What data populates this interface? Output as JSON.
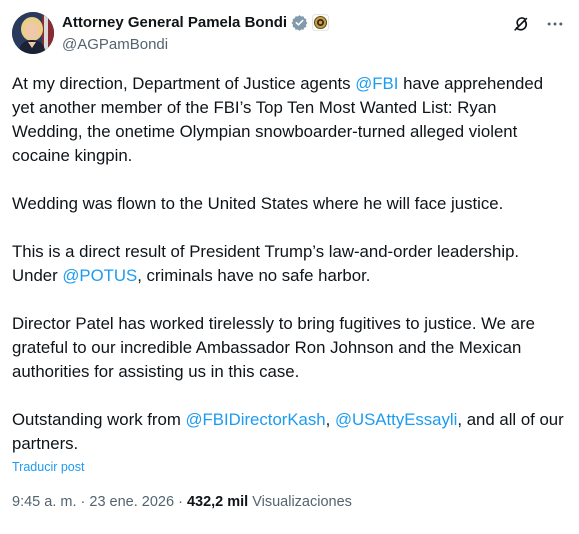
{
  "author": {
    "name": "Attorney General Pamela Bondi",
    "handle": "@AGPamBondi",
    "verified_color": "#829aab",
    "avatar_icon": "profile-photo"
  },
  "tweet": {
    "paragraphs": [
      [
        {
          "text": "At my direction, Department of Justice agents "
        },
        {
          "text": "@FBI",
          "link": true
        },
        {
          "text": " have apprehended yet another member of the FBI’s Top Ten Most Wanted List: Ryan Wedding, the onetime Olympian snowboarder-turned alleged violent cocaine kingpin."
        }
      ],
      [
        {
          "text": "Wedding was flown to the United States where he will face justice."
        }
      ],
      [
        {
          "text": "This is a direct result of President Trump’s law-and-order leadership. Under "
        },
        {
          "text": "@POTUS",
          "link": true
        },
        {
          "text": ", criminals have no safe harbor."
        }
      ],
      [
        {
          "text": "Director Patel has worked tirelessly to bring fugitives to justice. We are grateful to our incredible Ambassador Ron Johnson and the Mexican authorities for assisting us in this case."
        }
      ],
      [
        {
          "text": "Outstanding work from "
        },
        {
          "text": "@FBIDirectorKash",
          "link": true
        },
        {
          "text": ", "
        },
        {
          "text": "@USAttyEssayli",
          "link": true
        },
        {
          "text": ", and all of our partners."
        }
      ]
    ],
    "translate_label": "Traducir post"
  },
  "meta": {
    "time": "9:45 a. m.",
    "separator": " · ",
    "date": "23 ene. 2026",
    "views_count": "432,2 mil",
    "views_label": " Visualizaciones"
  },
  "colors": {
    "link": "#1d9bf0",
    "secondary_text": "#536471",
    "primary_text": "#0f1419"
  }
}
